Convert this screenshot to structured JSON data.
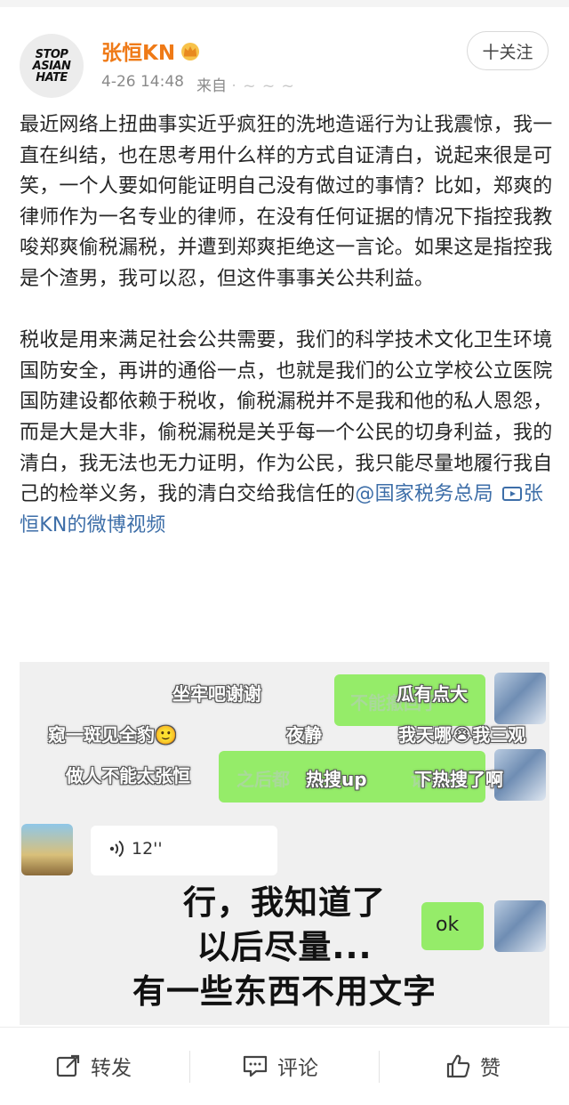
{
  "user": {
    "avatar_text": [
      "STOP",
      "ASIAN",
      "HATE"
    ],
    "name": "张恒KN",
    "badge_icon": "crown-icon",
    "time": "4-26 14:48",
    "source": "来自",
    "follow_label": "十关注"
  },
  "post": {
    "paragraph1": "最近网络上扭曲事实近乎疯狂的洗地造谣行为让我震惊，我一直在纠结，也在思考用什么样的方式自证清白，说起来很是可笑，一个人要如何能证明自己没有做过的事情？比如，郑爽的律师作为一名专业的律师，在没有任何证据的情况下指控我教唆郑爽偷税漏税，并遭到郑爽拒绝这一言论。如果这是指控我是个渣男，我可以忍，但这件事事关公共利益。",
    "paragraph2": "税收是用来满足社会公共需要，我们的科学技术文化卫生环境国防安全，再讲的通俗一点，也就是我们的公立学校公立医院国防建设都依赖于税收，偷税漏税并不是我和他的私人恩怨，而是大是大非，偷税漏税是关乎每一个公民的切身利益，我的清白，我无法也无力证明，作为公民，我只能尽量地履行我自己的检举义务，我的清白交给我信任的",
    "mention": "@国家税务总局",
    "video_link": "张恒KN的微博视频"
  },
  "video": {
    "danmu": [
      "坐牢吧谢谢",
      "瓜有点大",
      "窥一斑见全豹🙂",
      "夜静",
      "我天哪😭我三观",
      "做人不能太张恒",
      "热搜up",
      "下热搜了啊"
    ],
    "faint_texts": [
      "不能撤回了",
      "之后都",
      "话说好"
    ],
    "voice_duration": "12''",
    "ok_text": "ok",
    "caption_lines": [
      "行，我知道了",
      "以后尽量...",
      "有一些东西不用文字"
    ]
  },
  "actions": {
    "repost": "转发",
    "comment": "评论",
    "like": "赞"
  }
}
